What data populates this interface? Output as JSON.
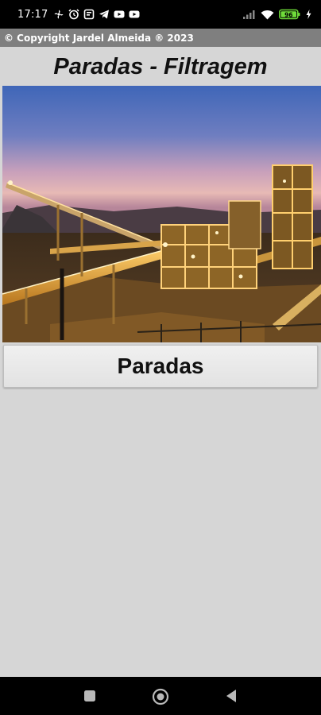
{
  "status_bar": {
    "time": "17:17",
    "battery_level": "96"
  },
  "app_bar": {
    "copyright": "© Copyright Jardel Almeida ® 2023"
  },
  "main": {
    "title": "Paradas - Filtragem",
    "button_label": "Paradas"
  },
  "nav_bar": {
    "icons": [
      "recents-square-icon",
      "home-circle-icon",
      "back-triangle-icon"
    ]
  },
  "colors": {
    "background": "#d6d6d6",
    "app_bar": "#7f7f7f",
    "status_bar": "#000000"
  }
}
